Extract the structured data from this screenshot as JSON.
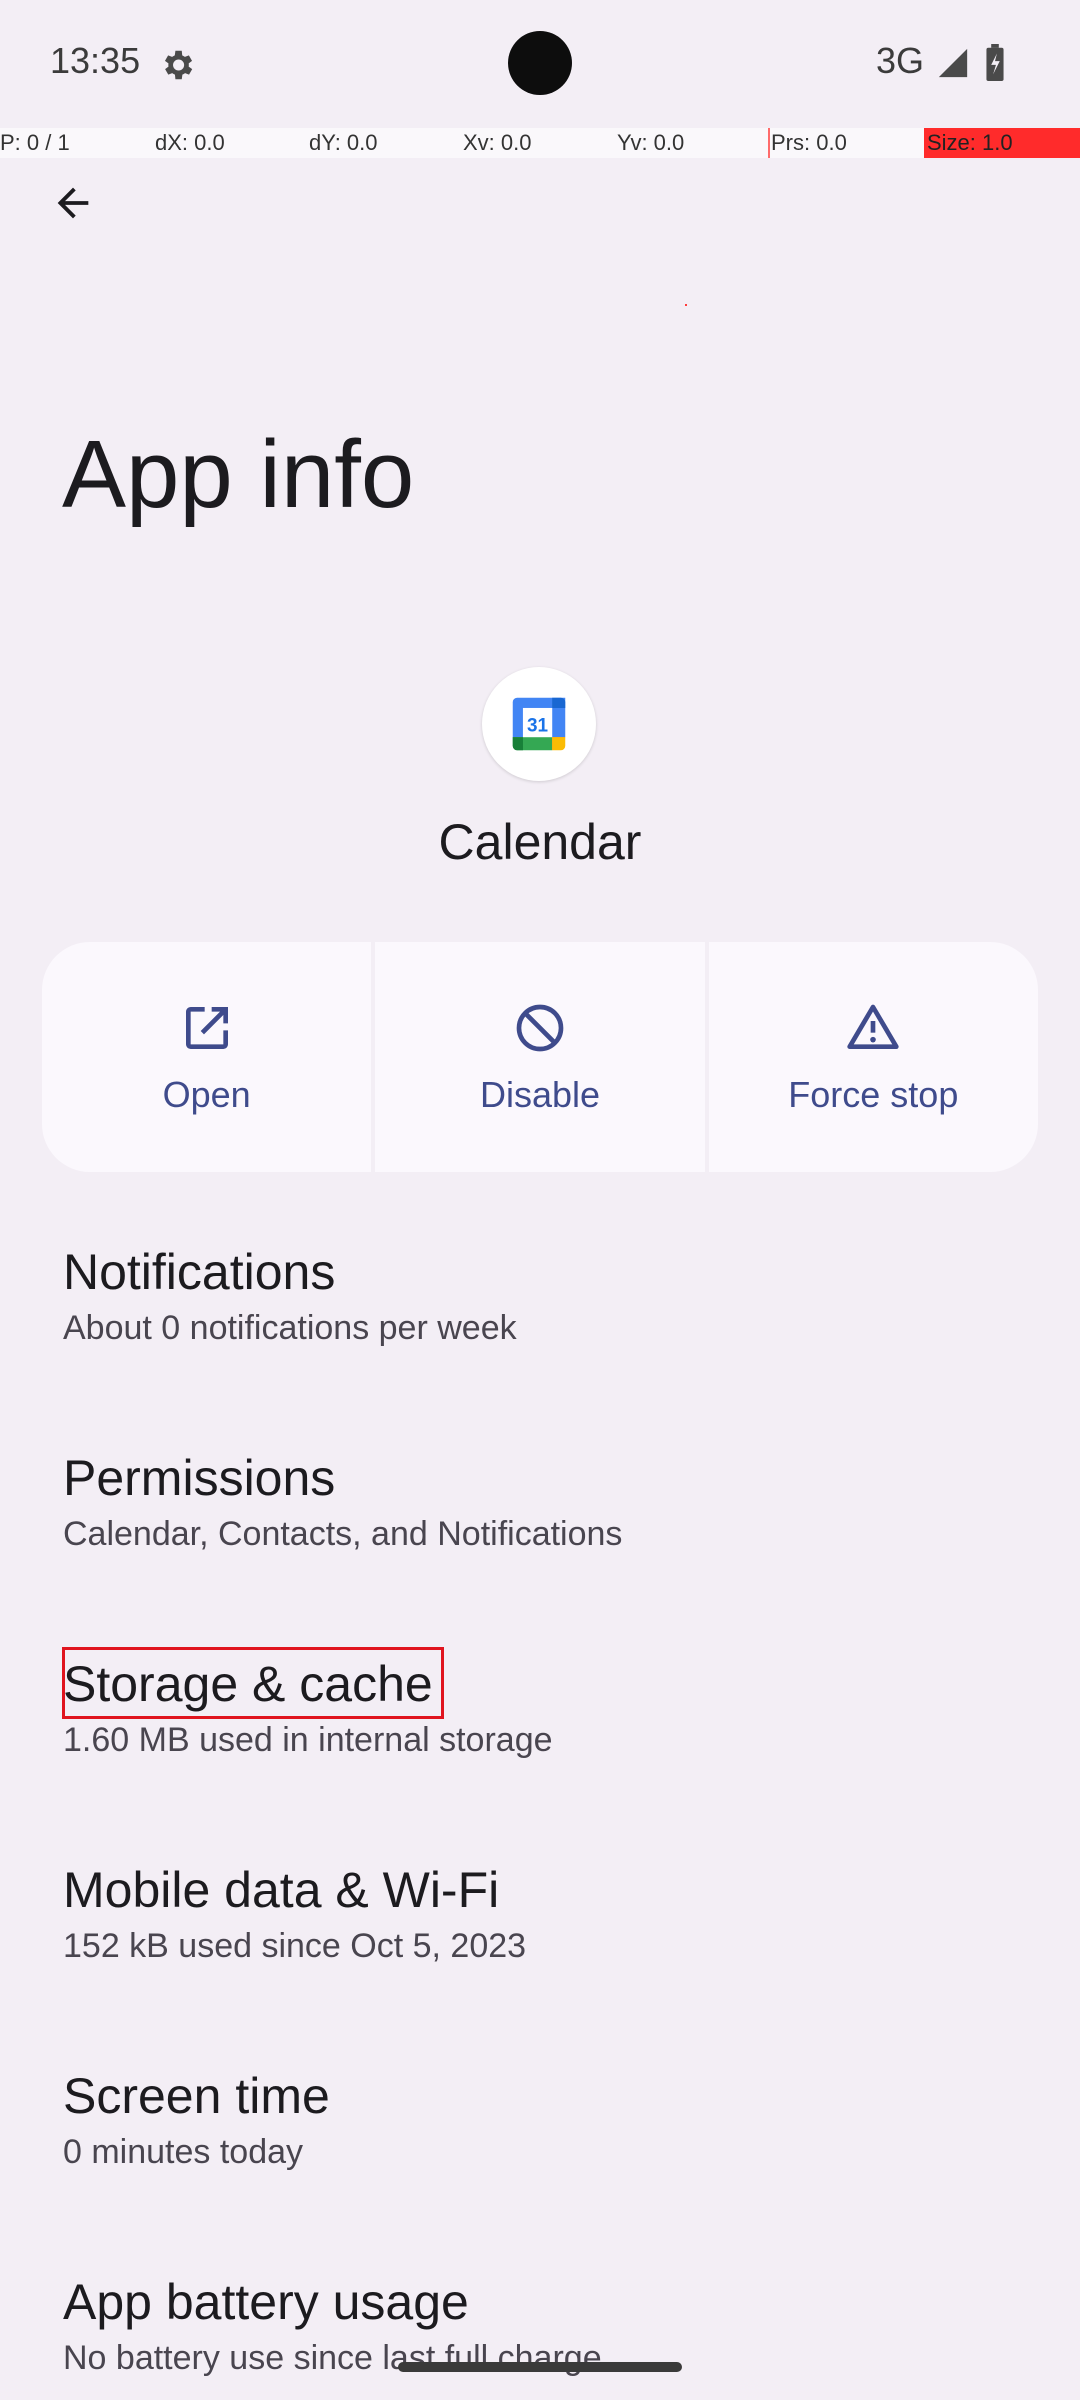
{
  "status_bar": {
    "time": "13:35",
    "network": "3G",
    "icons": [
      "settings-gear-icon",
      "signal-icon",
      "battery-icon"
    ]
  },
  "pointer_overlay": {
    "p": "P: 0 / 1",
    "dx": "dX: 0.0",
    "dy": "dY: 0.0",
    "xv": "Xv: 0.0",
    "yv": "Yv: 0.0",
    "prs": "Prs: 0.0",
    "size": "Size: 1.0"
  },
  "header": {
    "back_icon": "arrow-back-icon",
    "title": "App info"
  },
  "app": {
    "icon": "calendar-app-icon",
    "icon_day": "31",
    "name": "Calendar"
  },
  "actions": [
    {
      "label": "Open",
      "icon": "open-external-icon"
    },
    {
      "label": "Disable",
      "icon": "disable-icon"
    },
    {
      "label": "Force stop",
      "icon": "warning-triangle-icon"
    }
  ],
  "settings": [
    {
      "title": "Notifications",
      "subtitle": "About 0 notifications per week"
    },
    {
      "title": "Permissions",
      "subtitle": "Calendar, Contacts, and Notifications"
    },
    {
      "title": "Storage & cache",
      "subtitle": "1.60 MB used in internal storage"
    },
    {
      "title": "Mobile data & Wi-Fi",
      "subtitle": "152 kB used since Oct 5, 2023"
    },
    {
      "title": "Screen time",
      "subtitle": "0 minutes today"
    },
    {
      "title": "App battery usage",
      "subtitle": "No battery use since last full charge"
    }
  ],
  "colors": {
    "background": "#f3eef5",
    "action_tint": "#3f4b8c",
    "highlight_border": "#e0141e"
  }
}
